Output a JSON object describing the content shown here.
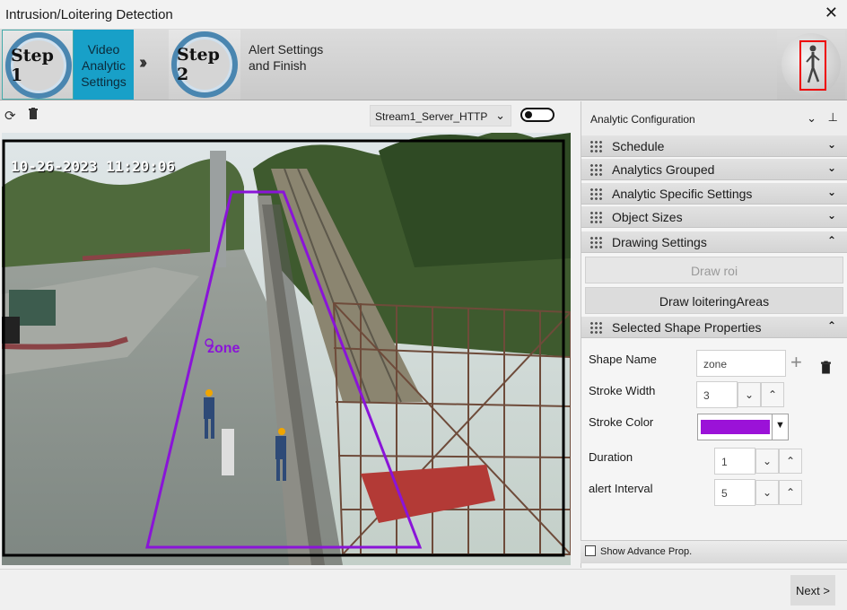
{
  "window": {
    "title": "Intrusion/Loitering Detection",
    "close_glyph": "✕"
  },
  "wizard": {
    "step1": {
      "badge": "Step 1",
      "label": "Video Analytic Settings"
    },
    "step2": {
      "badge": "Step 2",
      "label": "Alert Settings and Finish"
    },
    "separator": "»"
  },
  "video_toolbar": {
    "refresh_icon": "refresh-icon",
    "delete_icon": "trash-icon",
    "stream": "Stream1_Server_HTTP"
  },
  "video": {
    "timestamp": "10-26-2023 11:20:06",
    "zone_label": "zone",
    "zone_color": "#8a14d8"
  },
  "panel": {
    "title": "Analytic Configuration",
    "sections": {
      "schedule": "Schedule",
      "analytics_grouped": "Analytics Grouped",
      "analytic_specific": "Analytic Specific Settings",
      "object_sizes": "Object Sizes",
      "drawing_settings": "Drawing Settings",
      "selected_shape": "Selected Shape Properties"
    },
    "draw_roi": "Draw roi",
    "draw_loitering": "Draw loiteringAreas",
    "props": {
      "shape_name_label": "Shape Name",
      "shape_name_value": "zone",
      "stroke_width_label": "Stroke Width",
      "stroke_width_value": "3",
      "stroke_color_label": "Stroke Color",
      "stroke_color_value": "#9b12d8",
      "duration_label": "Duration",
      "duration_value": "1",
      "alert_interval_label": "alert Interval",
      "alert_interval_value": "5"
    },
    "show_advance": "Show Advance Prop."
  },
  "footer": {
    "next": "Next >"
  }
}
